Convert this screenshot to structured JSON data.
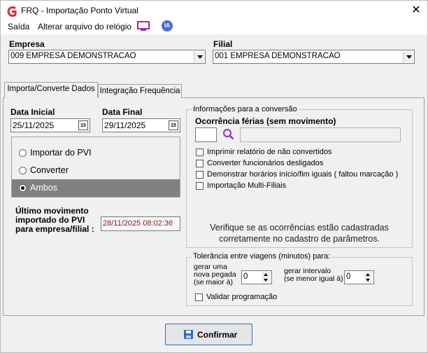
{
  "window": {
    "title": "FRQ - Importação Ponto Virtual",
    "close_glyph": "✕",
    "app_icon": "app-logo-icon",
    "accent_color": "#d72d36"
  },
  "menu": {
    "items": [
      "Saída",
      "Alterar arquivo do relógio"
    ],
    "monitor_icon": "monitor-icon",
    "ia_label": "IA"
  },
  "empresa": {
    "label": "Empresa",
    "value": "009 EMPRESA DEMONSTRACAO"
  },
  "filial": {
    "label": "Filial",
    "value": "001 EMPRESA DEMONSTRACAO"
  },
  "tabs": [
    {
      "label": "Importa/Converte Dados",
      "active": true
    },
    {
      "label": "Integração Frequência",
      "active": false
    }
  ],
  "dates": {
    "initial_label": "Data Inicial",
    "initial_value": "25/11/2025",
    "final_label": "Data Final",
    "final_value": "29/11/2025",
    "calendar_glyph": "15"
  },
  "modes": {
    "options": [
      "Importar do PVI",
      "Converter",
      "Ambos"
    ],
    "selected": "Ambos"
  },
  "last_movement": {
    "label_lines": [
      "Último movimento",
      "importado do PVI",
      "para empresa/filial :"
    ],
    "value": "28/11/2025  08:02:36"
  },
  "conversion": {
    "group_title": "Informações para a conversão",
    "vacation_label": "Ocorrência férias (sem movimento)",
    "vacation_code": "",
    "vacation_desc": "",
    "checkboxes": [
      {
        "label": "Imprimir relatório de não convertidos",
        "checked": false
      },
      {
        "label": "Converter funcionários desligados",
        "checked": false
      },
      {
        "label": "Demonstrar horários início/fim iguais ( faltou marcação )",
        "checked": false
      },
      {
        "label": "Importação Multi-Filiais",
        "checked": false
      }
    ],
    "note_lines": [
      "Verifique se as ocorrências estão cadastradas",
      "corretamente  no cadastro de parâmetros."
    ]
  },
  "tolerance": {
    "group_title": "Tolerância entre viagens (minutos) para:",
    "new_label_lines": [
      "gerar uma",
      "nova pegada",
      "(se maior à)"
    ],
    "new_value": "0",
    "interval_label_lines": [
      "gerar intervalo",
      "(se menor igual à)"
    ],
    "interval_value": "0",
    "validate_label": "Validar programação",
    "validate_checked": false
  },
  "confirm": {
    "label": "Confirmar"
  }
}
